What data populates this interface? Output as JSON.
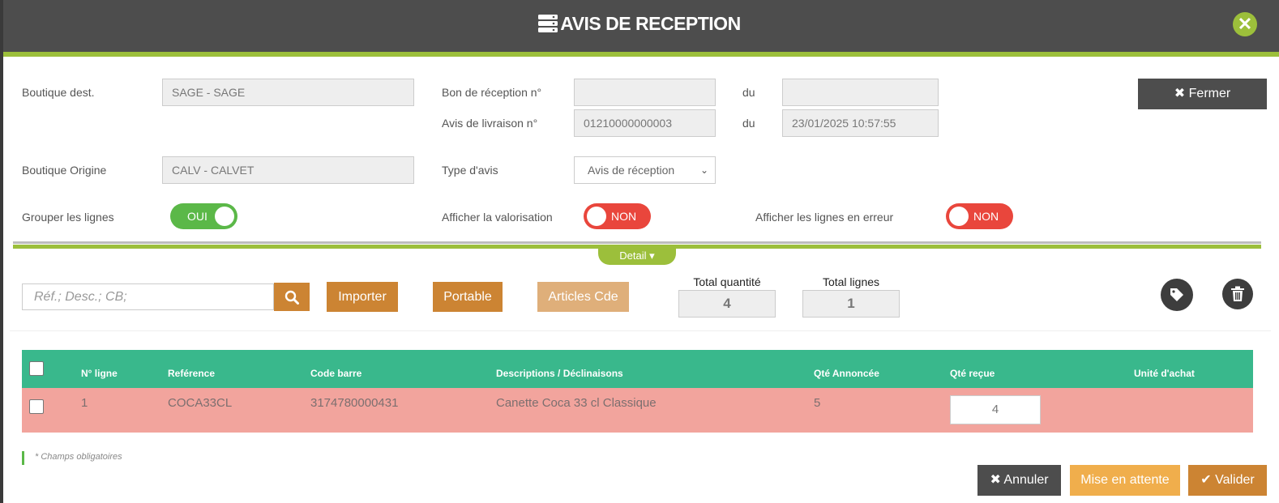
{
  "header": {
    "title": "AVIS DE RECEPTION"
  },
  "colors": {
    "header": "#4d4d4d",
    "accent_green": "#9cbf3b",
    "orange": "#cc8433",
    "orange_light": "#dfaf7a",
    "table_header": "#39b88c",
    "row_error": "#f2a49d",
    "toggle_on": "#5bb848",
    "toggle_off": "#e9463c",
    "pending": "#f0ae4c"
  },
  "form": {
    "boutique_dest": {
      "label": "Boutique dest.",
      "value": "SAGE - SAGE"
    },
    "bon_reception": {
      "label": "Bon de réception n°",
      "value": "",
      "du_label": "du",
      "date": ""
    },
    "avis_livraison": {
      "label": "Avis de livraison n°",
      "value": "01210000000003",
      "du_label": "du",
      "date": "23/01/2025 10:57:55"
    },
    "boutique_origine": {
      "label": "Boutique Origine",
      "value": "CALV - CALVET"
    },
    "type_avis": {
      "label": "Type d'avis",
      "value": "Avis de réception"
    },
    "fermer_label": "Fermer"
  },
  "toggles": {
    "grouper": {
      "label": "Grouper les lignes",
      "state": "OUI"
    },
    "valorisation": {
      "label": "Afficher la valorisation",
      "state": "NON"
    },
    "erreurs": {
      "label": "Afficher les lignes en erreur",
      "state": "NON"
    }
  },
  "detail": {
    "tab_label": "Detail"
  },
  "toolbar": {
    "search_placeholder": "Réf.; Desc.; CB;",
    "importer": "Importer",
    "portable": "Portable",
    "articles_cde": "Articles Cde",
    "total_quantite_label": "Total quantité",
    "total_quantite": "4",
    "total_lignes_label": "Total lignes",
    "total_lignes": "1"
  },
  "table": {
    "columns": [
      "N° ligne",
      "Reférence",
      "Code barre",
      "Descriptions / Déclinaisons",
      "Qté Annoncée",
      "Qté reçue",
      "Unité d'achat"
    ],
    "rows": [
      {
        "ligne": "1",
        "reference": "COCA33CL",
        "code_barre": "3174780000431",
        "description": "Canette Coca 33 cl Classique",
        "qte_annoncee": "5",
        "qte_recue": "4",
        "unite": ""
      }
    ]
  },
  "footer": {
    "required_note": "* Champs obligatoires",
    "annuler": "Annuler",
    "mise_en_attente": "Mise en attente",
    "valider": "Valider"
  }
}
